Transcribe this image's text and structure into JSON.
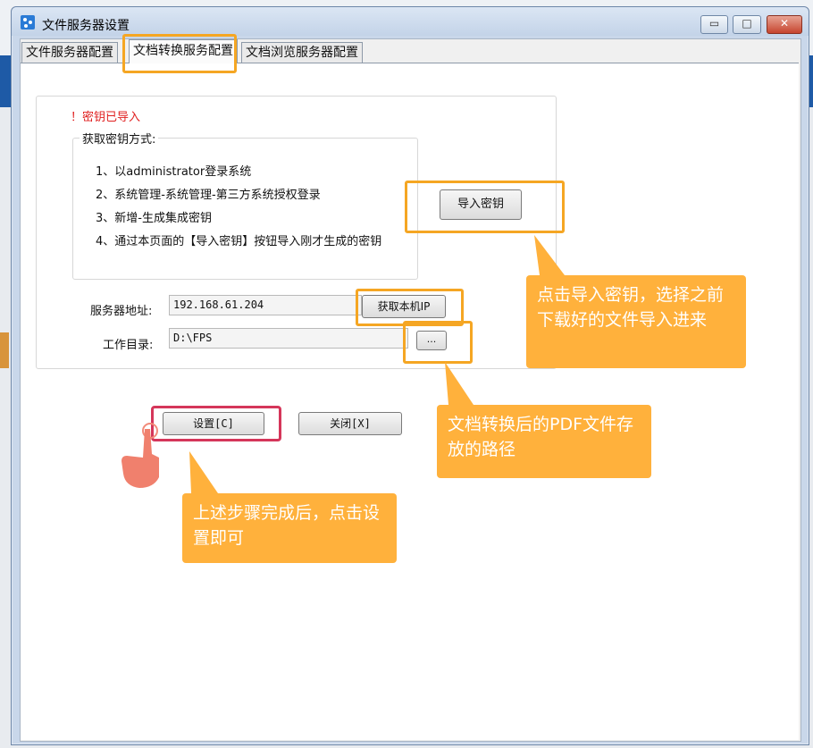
{
  "window": {
    "title": "文件服务器设置",
    "min_symbol": "▭",
    "max_symbol": "□",
    "close_symbol": "✕"
  },
  "tabs": [
    {
      "label": "文件服务器配置"
    },
    {
      "label": "文档转换服务配置"
    },
    {
      "label": "文档浏览服务器配置"
    }
  ],
  "key_status": "！密钥已导入",
  "key_method": {
    "title": "获取密钥方式:",
    "steps": [
      "1、以administrator登录系统",
      "2、系统管理-系统管理-第三方系统授权登录",
      "3、新增-生成集成密钥",
      "4、通过本页面的【导入密钥】按钮导入刚才生成的密钥"
    ]
  },
  "import_key_button": "导入密钥",
  "server": {
    "label": "服务器地址:",
    "value": "192.168.61.204",
    "get_ip_button": "获取本机IP"
  },
  "workdir": {
    "label": "工作目录:",
    "value": "D:\\FPS",
    "browse_button": "..."
  },
  "actions": {
    "set_button": "设置[C]",
    "close_button": "关闭[X]"
  },
  "callouts": {
    "import": "点击导入密钥，选择之前下载好的文件导入进来",
    "path": "文档转换后的PDF文件存放的路径",
    "set": "上述步骤完成后，点击设置即可"
  },
  "colors": {
    "highlight_orange": "#f5a623",
    "highlight_red": "#d5365a",
    "callout_bg": "#ffb13c",
    "status_red": "#e02020"
  },
  "icons": {
    "app": "app-icon",
    "hand": "pointing-hand-icon"
  }
}
